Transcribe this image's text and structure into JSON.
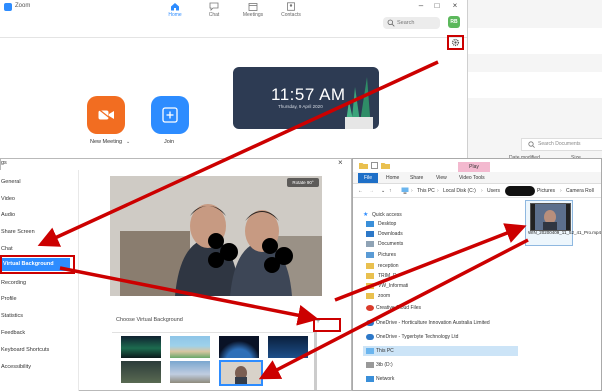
{
  "zoom": {
    "title": "Zoom",
    "nav": [
      {
        "label": "Home"
      },
      {
        "label": "Chat"
      },
      {
        "label": "Meetings"
      },
      {
        "label": "Contacts"
      }
    ],
    "search_placeholder": "Search",
    "avatar_initials": "RB",
    "actions": {
      "new_meeting": "New Meeting",
      "join": "Join"
    },
    "clock": {
      "time": "11:57 AM",
      "date": "Thursday, 9 April 2020"
    }
  },
  "behind_window": {
    "search_placeholder": "Search Documents",
    "col_date": "Date modified",
    "col_size": "Size"
  },
  "settings": {
    "title": "gs",
    "sidebar": [
      "General",
      "Video",
      "Audio",
      "Share Screen",
      "Chat",
      "Virtual Background",
      "Recording",
      "Profile",
      "Statistics",
      "Feedback",
      "Keyboard Shortcuts",
      "Accessibility"
    ],
    "active_index": 5,
    "rotate_label": "Rotate 90°",
    "choose_label": "Choose Virtual Background",
    "add_label": "+"
  },
  "explorer": {
    "context_tab": "Play",
    "context_group": "Video Tools",
    "ribbon_tabs": [
      "File",
      "Home",
      "Share",
      "View",
      "Video Tools"
    ],
    "breadcrumb": [
      "This PC",
      "Local Disk (C:)",
      "Users",
      "Pictures",
      "Camera Roll"
    ],
    "tree": [
      {
        "label": "Quick access"
      },
      {
        "label": "Desktop"
      },
      {
        "label": "Downloads"
      },
      {
        "label": "Documents"
      },
      {
        "label": "Pictures"
      },
      {
        "label": "reception"
      },
      {
        "label": "TRIM_D"
      },
      {
        "label": "VW_Informati"
      },
      {
        "label": "zoom"
      },
      {
        "label": "Creative Cloud Files"
      },
      {
        "label": "OneDrive - Horticulture Innovation Australia Limited"
      },
      {
        "label": "OneDrive - Tygerbyte Technology Ltd"
      },
      {
        "label": "This PC"
      },
      {
        "label": "3tb (D:)"
      },
      {
        "label": "Network"
      }
    ],
    "file_name": "WIN_20200409_11_52_41_Pro.mp4"
  },
  "colors": {
    "accent": "#2d8cff",
    "annotation_red": "#cc0000",
    "new_meeting": "#f26d21"
  }
}
